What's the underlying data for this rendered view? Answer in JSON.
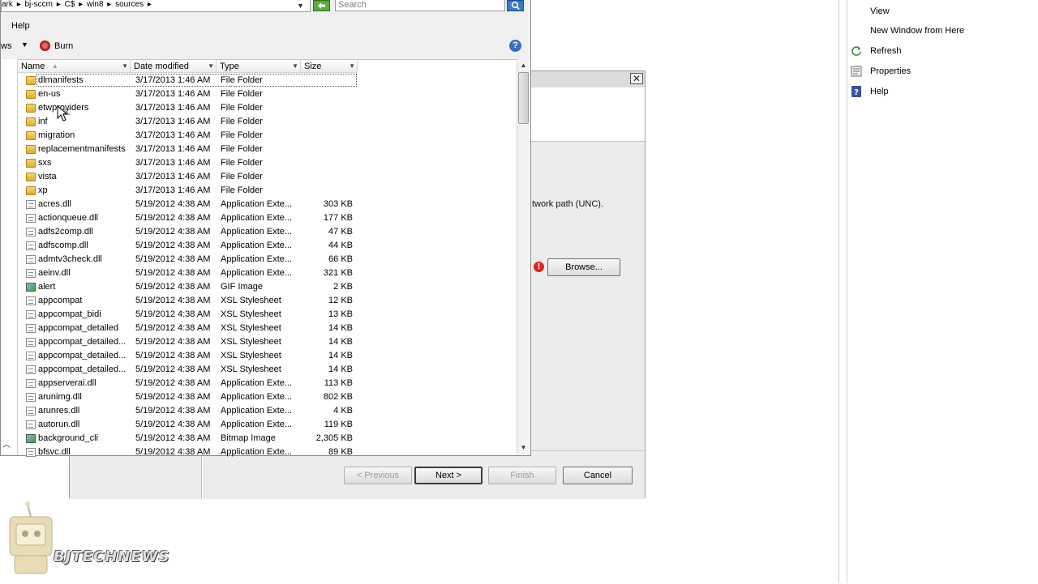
{
  "explorer": {
    "address_segments": [
      "ark",
      "▸",
      "bj-sccm",
      "▸",
      "C$",
      "▸",
      "win8",
      "▸",
      "sources",
      "▸"
    ],
    "search_placeholder": "Search",
    "menu": {
      "help": "Help"
    },
    "toolbar": {
      "views_partial": "ws",
      "burn": "Burn"
    },
    "columns": {
      "name": "Name",
      "date": "Date modified",
      "type": "Type",
      "size": "Size"
    },
    "files": [
      {
        "name": "dlmanifests",
        "date": "3/17/2013 1:46 AM",
        "type": "File Folder",
        "size": "",
        "icon": "folder"
      },
      {
        "name": "en-us",
        "date": "3/17/2013 1:46 AM",
        "type": "File Folder",
        "size": "",
        "icon": "folder"
      },
      {
        "name": "etwproviders",
        "date": "3/17/2013 1:46 AM",
        "type": "File Folder",
        "size": "",
        "icon": "folder"
      },
      {
        "name": "inf",
        "date": "3/17/2013 1:46 AM",
        "type": "File Folder",
        "size": "",
        "icon": "folder"
      },
      {
        "name": "migration",
        "date": "3/17/2013 1:46 AM",
        "type": "File Folder",
        "size": "",
        "icon": "folder"
      },
      {
        "name": "replacementmanifests",
        "date": "3/17/2013 1:46 AM",
        "type": "File Folder",
        "size": "",
        "icon": "folder"
      },
      {
        "name": "sxs",
        "date": "3/17/2013 1:46 AM",
        "type": "File Folder",
        "size": "",
        "icon": "folder"
      },
      {
        "name": "vista",
        "date": "3/17/2013 1:46 AM",
        "type": "File Folder",
        "size": "",
        "icon": "folder"
      },
      {
        "name": "xp",
        "date": "3/17/2013 1:46 AM",
        "type": "File Folder",
        "size": "",
        "icon": "folder"
      },
      {
        "name": "acres.dll",
        "date": "5/19/2012 4:38 AM",
        "type": "Application Exte...",
        "size": "303 KB",
        "icon": "file"
      },
      {
        "name": "actionqueue.dll",
        "date": "5/19/2012 4:38 AM",
        "type": "Application Exte...",
        "size": "177 KB",
        "icon": "file"
      },
      {
        "name": "adfs2comp.dll",
        "date": "5/19/2012 4:38 AM",
        "type": "Application Exte...",
        "size": "47 KB",
        "icon": "file"
      },
      {
        "name": "adfscomp.dll",
        "date": "5/19/2012 4:38 AM",
        "type": "Application Exte...",
        "size": "44 KB",
        "icon": "file"
      },
      {
        "name": "admtv3check.dll",
        "date": "5/19/2012 4:38 AM",
        "type": "Application Exte...",
        "size": "66 KB",
        "icon": "file"
      },
      {
        "name": "aeinv.dll",
        "date": "5/19/2012 4:38 AM",
        "type": "Application Exte...",
        "size": "321 KB",
        "icon": "file"
      },
      {
        "name": "alert",
        "date": "5/19/2012 4:38 AM",
        "type": "GIF Image",
        "size": "2 KB",
        "icon": "image"
      },
      {
        "name": "appcompat",
        "date": "5/19/2012 4:38 AM",
        "type": "XSL Stylesheet",
        "size": "12 KB",
        "icon": "file"
      },
      {
        "name": "appcompat_bidi",
        "date": "5/19/2012 4:38 AM",
        "type": "XSL Stylesheet",
        "size": "13 KB",
        "icon": "file"
      },
      {
        "name": "appcompat_detailed",
        "date": "5/19/2012 4:38 AM",
        "type": "XSL Stylesheet",
        "size": "14 KB",
        "icon": "file"
      },
      {
        "name": "appcompat_detailed...",
        "date": "5/19/2012 4:38 AM",
        "type": "XSL Stylesheet",
        "size": "14 KB",
        "icon": "file"
      },
      {
        "name": "appcompat_detailed...",
        "date": "5/19/2012 4:38 AM",
        "type": "XSL Stylesheet",
        "size": "14 KB",
        "icon": "file"
      },
      {
        "name": "appcompat_detailed...",
        "date": "5/19/2012 4:38 AM",
        "type": "XSL Stylesheet",
        "size": "14 KB",
        "icon": "file"
      },
      {
        "name": "appserverai.dll",
        "date": "5/19/2012 4:38 AM",
        "type": "Application Exte...",
        "size": "113 KB",
        "icon": "file"
      },
      {
        "name": "arunimg.dll",
        "date": "5/19/2012 4:38 AM",
        "type": "Application Exte...",
        "size": "802 KB",
        "icon": "file"
      },
      {
        "name": "arunres.dll",
        "date": "5/19/2012 4:38 AM",
        "type": "Application Exte...",
        "size": "4 KB",
        "icon": "file"
      },
      {
        "name": "autorun.dll",
        "date": "5/19/2012 4:38 AM",
        "type": "Application Exte...",
        "size": "119 KB",
        "icon": "file"
      },
      {
        "name": "background_cli",
        "date": "5/19/2012 4:38 AM",
        "type": "Bitmap Image",
        "size": "2,305 KB",
        "icon": "image"
      },
      {
        "name": "bfsvc.dll",
        "date": "5/19/2012 4:38 AM",
        "type": "Application Exte...",
        "size": "89 KB",
        "icon": "file"
      }
    ]
  },
  "wizard": {
    "close_glyph": "✕",
    "unc_text": "twork path (UNC).",
    "browse_label": "Browse...",
    "previous_label": "< Previous",
    "next_label": "Next >",
    "finish_label": "Finish",
    "cancel_label": "Cancel"
  },
  "actions_pane": {
    "items": [
      {
        "label": "View",
        "icon": "none"
      },
      {
        "label": "New Window from Here",
        "icon": "none"
      },
      {
        "label": "Refresh",
        "icon": "refresh-icon"
      },
      {
        "label": "Properties",
        "icon": "properties-icon"
      },
      {
        "label": "Help",
        "icon": "help-icon"
      }
    ]
  },
  "watermark": {
    "text": "BJTECHNEWS"
  },
  "colors": {
    "folder": "#e8bb45",
    "accent_blue": "#3a6fbf",
    "error_red": "#d8261c",
    "refresh_green": "#5cab3b"
  }
}
